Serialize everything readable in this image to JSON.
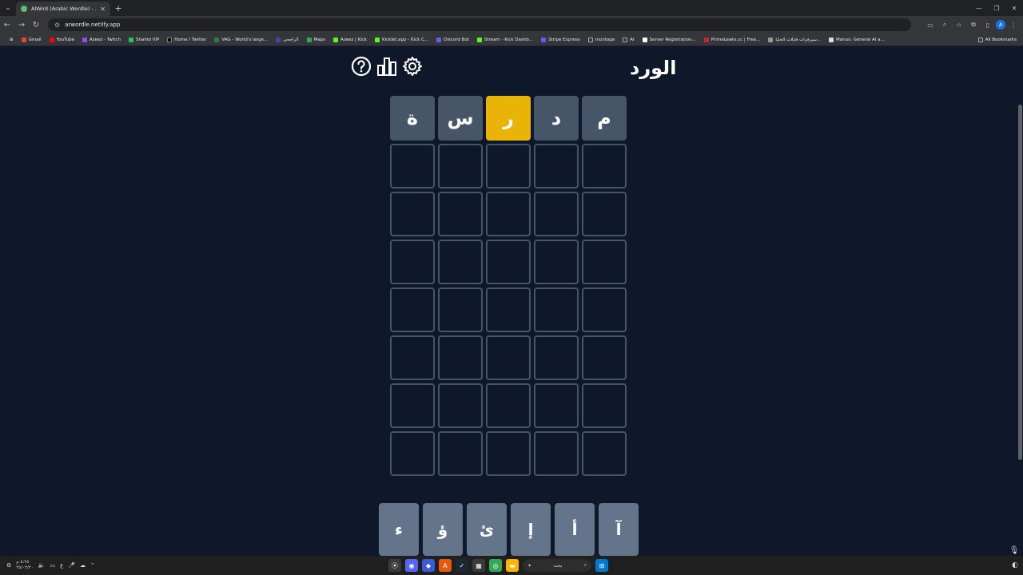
{
  "browser": {
    "tab_title": "AlWird (Arabic Wordle) - الورد",
    "url": "arwordle.netlify.app",
    "bookmarks": [
      "Gmail",
      "YouTube",
      "Azeez - Twitch",
      "Shahid VIP",
      "Home / Twitter",
      "VAG - World's large...",
      "الراجحي",
      "Maps",
      "Azeez | Kick",
      "Kicklet.app - Kick C...",
      "Discord Bot",
      "Stream - Kick Dashb...",
      "Stripe Express",
      "montage",
      "AI",
      "Server Registration...",
      "PrimeLeaks.cc | Free...",
      "سيرفرات فايلات الحليا...",
      "Manus: General AI a..."
    ],
    "all_bookmarks": "All Bookmarks",
    "profile_initial": "A"
  },
  "app": {
    "title": "الورد",
    "grid": [
      [
        {
          "letter": "م",
          "state": "filled"
        },
        {
          "letter": "د",
          "state": "filled"
        },
        {
          "letter": "ر",
          "state": "present"
        },
        {
          "letter": "س",
          "state": "filled"
        },
        {
          "letter": "ة",
          "state": "filled"
        }
      ],
      [
        {
          "letter": ""
        },
        {
          "letter": ""
        },
        {
          "letter": ""
        },
        {
          "letter": ""
        },
        {
          "letter": ""
        }
      ],
      [
        {
          "letter": ""
        },
        {
          "letter": ""
        },
        {
          "letter": ""
        },
        {
          "letter": ""
        },
        {
          "letter": ""
        }
      ],
      [
        {
          "letter": ""
        },
        {
          "letter": ""
        },
        {
          "letter": ""
        },
        {
          "letter": ""
        },
        {
          "letter": ""
        }
      ],
      [
        {
          "letter": ""
        },
        {
          "letter": ""
        },
        {
          "letter": ""
        },
        {
          "letter": ""
        },
        {
          "letter": ""
        }
      ],
      [
        {
          "letter": ""
        },
        {
          "letter": ""
        },
        {
          "letter": ""
        },
        {
          "letter": ""
        },
        {
          "letter": ""
        }
      ],
      [
        {
          "letter": ""
        },
        {
          "letter": ""
        },
        {
          "letter": ""
        },
        {
          "letter": ""
        },
        {
          "letter": ""
        }
      ],
      [
        {
          "letter": ""
        },
        {
          "letter": ""
        },
        {
          "letter": ""
        },
        {
          "letter": ""
        },
        {
          "letter": ""
        }
      ]
    ],
    "keyboard_row": [
      "آ",
      "أ",
      "إ",
      "ئ",
      "ؤ",
      "ء"
    ],
    "colors": {
      "background": "#0f172a",
      "tile_filled": "#475569",
      "tile_present": "#eab308",
      "key": "#64748b"
    }
  },
  "taskbar": {
    "clock_time": "٥:٢٥ م",
    "clock_date": "٢٥/٠٢/٢٠",
    "lang": "ع",
    "search_placeholder": "بحث"
  }
}
